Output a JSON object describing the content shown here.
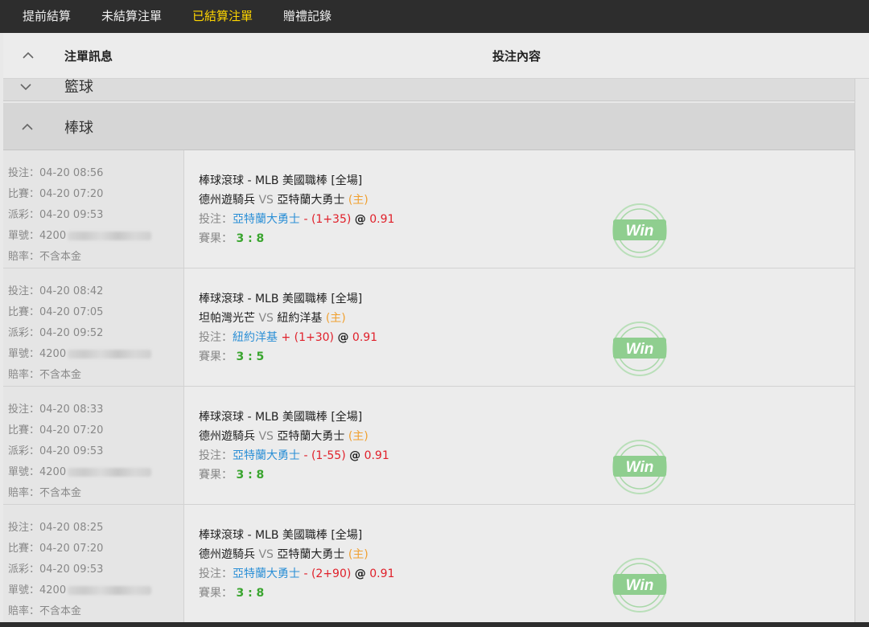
{
  "tabs": [
    {
      "label": "提前結算",
      "active": false
    },
    {
      "label": "未結算注單",
      "active": false
    },
    {
      "label": "已結算注單",
      "active": true
    },
    {
      "label": "贈禮記錄",
      "active": false
    }
  ],
  "header": {
    "info_label": "注單訊息",
    "content_label": "投注內容"
  },
  "groups": {
    "collapsed_label": "籃球",
    "expanded_label": "棒球"
  },
  "labels": {
    "bet_time": "投注：",
    "match_time": "比賽：",
    "payout_time": "派彩：",
    "order_no": "單號：",
    "odds_type": "賠率：",
    "bet": "投注：",
    "result": "賽果：",
    "vs": "VS",
    "home": "(主)",
    "at": "@",
    "win": "Win"
  },
  "colors": {
    "active_tab": "#ffd600",
    "team": "#2b8fd6",
    "handicap": "#e0202a",
    "score": "#3aa52f",
    "home": "#f0a030",
    "win_badge": "#8fce8f"
  },
  "bets": [
    {
      "bet_time": "04-20 08:56",
      "match_time": "04-20 07:20",
      "payout_time": "04-20 09:53",
      "order_prefix": "4200",
      "odds_type": "不含本金",
      "league": "棒球滾球 - MLB 美國職棒 [全場]",
      "team_a": "德州遊騎兵",
      "team_b": "亞特蘭大勇士",
      "pick": "亞特蘭大勇士",
      "handicap": "- (1+35)",
      "odds": "0.91",
      "score": "3 : 8",
      "status": "Win"
    },
    {
      "bet_time": "04-20 08:42",
      "match_time": "04-20 07:05",
      "payout_time": "04-20 09:52",
      "order_prefix": "4200",
      "odds_type": "不含本金",
      "league": "棒球滾球 - MLB 美國職棒 [全場]",
      "team_a": "坦帕灣光芒",
      "team_b": "紐約洋基",
      "pick": "紐約洋基",
      "handicap": "+ (1+30)",
      "odds": "0.91",
      "score": "3 : 5",
      "status": "Win"
    },
    {
      "bet_time": "04-20 08:33",
      "match_time": "04-20 07:20",
      "payout_time": "04-20 09:53",
      "order_prefix": "4200",
      "odds_type": "不含本金",
      "league": "棒球滾球 - MLB 美國職棒 [全場]",
      "team_a": "德州遊騎兵",
      "team_b": "亞特蘭大勇士",
      "pick": "亞特蘭大勇士",
      "handicap": "- (1-55)",
      "odds": "0.91",
      "score": "3 : 8",
      "status": "Win"
    },
    {
      "bet_time": "04-20 08:25",
      "match_time": "04-20 07:20",
      "payout_time": "04-20 09:53",
      "order_prefix": "4200",
      "odds_type": "不含本金",
      "league": "棒球滾球 - MLB 美國職棒 [全場]",
      "team_a": "德州遊騎兵",
      "team_b": "亞特蘭大勇士",
      "pick": "亞特蘭大勇士",
      "handicap": "- (2+90)",
      "odds": "0.91",
      "score": "3 : 8",
      "status": "Win"
    }
  ]
}
